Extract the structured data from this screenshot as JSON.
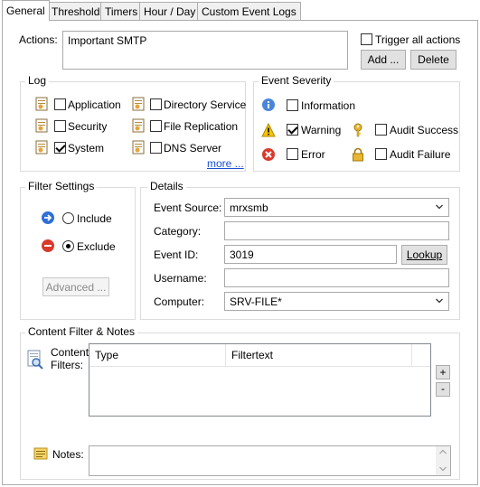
{
  "tabs": [
    {
      "label": "General",
      "active": true
    },
    {
      "label": "Threshold",
      "active": false
    },
    {
      "label": "Timers",
      "active": false
    },
    {
      "label": "Hour / Day",
      "active": false
    },
    {
      "label": "Custom Event Logs",
      "active": false
    }
  ],
  "actions": {
    "label": "Actions:",
    "value": "Important SMTP",
    "trigger_all_label": "Trigger all actions",
    "trigger_all_checked": false,
    "add_label": "Add ...",
    "delete_label": "Delete"
  },
  "log": {
    "title": "Log",
    "items": [
      {
        "label": "Application",
        "checked": false,
        "icon": "log-icon"
      },
      {
        "label": "Directory Service",
        "checked": false,
        "icon": "log-icon"
      },
      {
        "label": "Security",
        "checked": false,
        "icon": "log-icon"
      },
      {
        "label": "File Replication",
        "checked": false,
        "icon": "log-icon"
      },
      {
        "label": "System",
        "checked": true,
        "icon": "log-icon"
      },
      {
        "label": "DNS Server",
        "checked": false,
        "icon": "log-icon"
      }
    ],
    "more_label": "more ..."
  },
  "severity": {
    "title": "Event Severity",
    "items": [
      {
        "label": "Information",
        "checked": false,
        "icon": "info-icon"
      },
      {
        "label": "Warning",
        "checked": true,
        "icon": "warning-icon"
      },
      {
        "label": "Audit Success",
        "checked": false,
        "icon": "key-icon"
      },
      {
        "label": "Error",
        "checked": false,
        "icon": "error-icon"
      },
      {
        "label": "Audit Failure",
        "checked": false,
        "icon": "lock-icon"
      }
    ]
  },
  "filter": {
    "title": "Filter Settings",
    "include_label": "Include",
    "exclude_label": "Exclude",
    "selected": "exclude",
    "advanced_label": "Advanced ..."
  },
  "details": {
    "title": "Details",
    "event_source_label": "Event Source:",
    "event_source_value": "mrxsmb",
    "category_label": "Category:",
    "category_value": "",
    "event_id_label": "Event ID:",
    "event_id_value": "3019",
    "lookup_label": "Lookup",
    "username_label": "Username:",
    "username_value": "",
    "computer_label": "Computer:",
    "computer_value": "SRV-FILE*"
  },
  "content": {
    "title": "Content Filter & Notes",
    "filters_label_1": "Content",
    "filters_label_2": "Filters:",
    "columns": [
      "Type",
      "Filtertext"
    ],
    "rows": [],
    "add_label": "+",
    "remove_label": "-",
    "notes_label": "Notes:",
    "notes_value": ""
  },
  "colors": {
    "accent_blue": "#2f6fd6",
    "error_red": "#d93a2b",
    "warning_yellow": "#f5c400",
    "link_blue": "#1c4fd3"
  }
}
